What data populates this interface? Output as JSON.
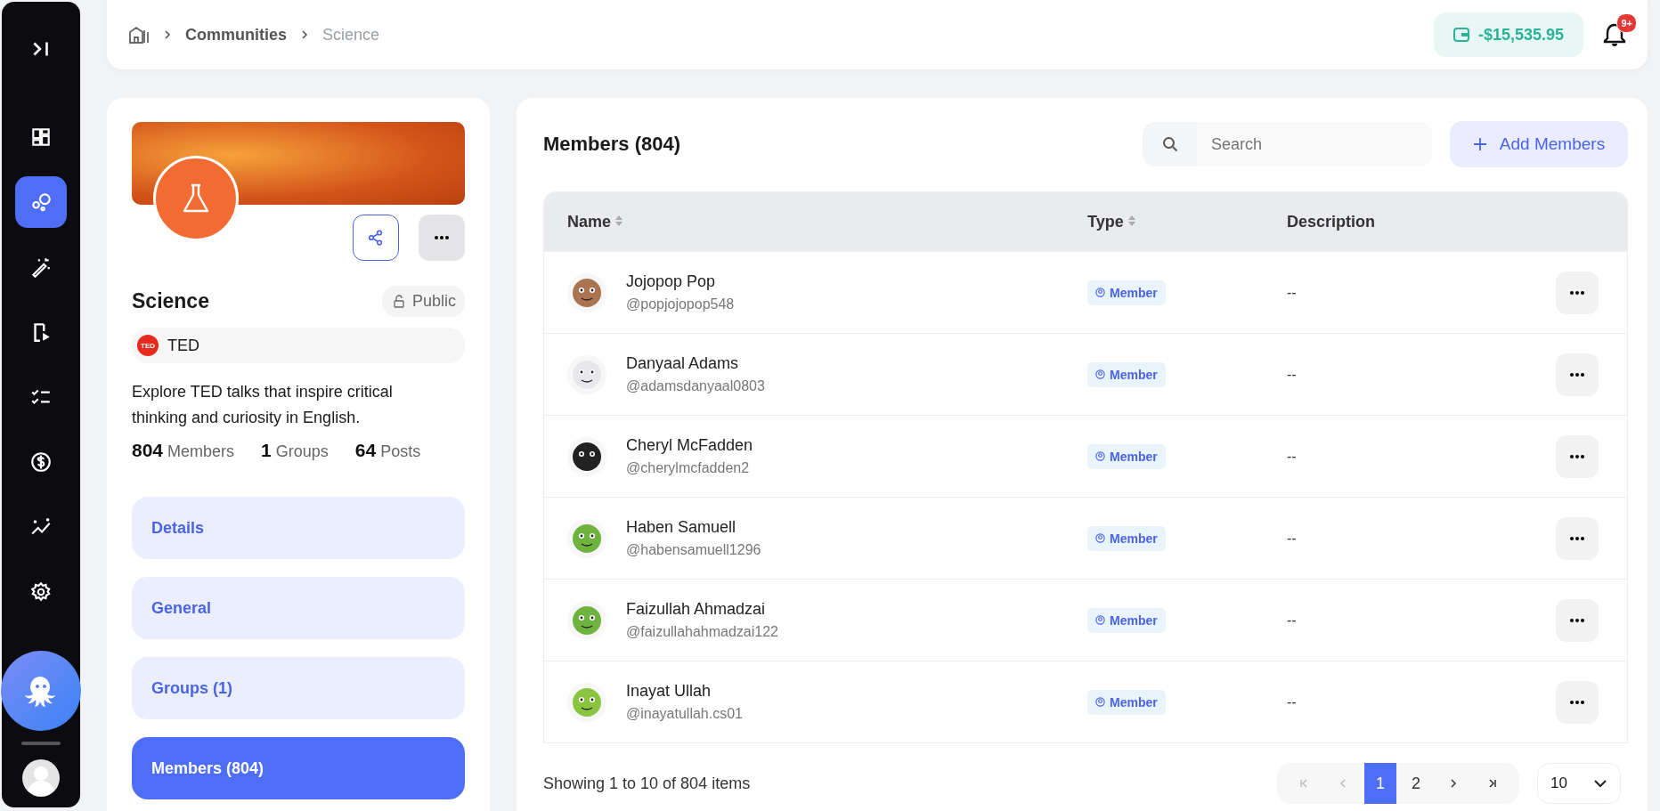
{
  "sidebar": {
    "items": [
      {
        "kind": "expand",
        "selected": false
      },
      {
        "kind": "dashboard",
        "selected": false
      },
      {
        "kind": "communities",
        "selected": true
      },
      {
        "kind": "magic",
        "selected": false
      },
      {
        "kind": "video",
        "selected": false
      },
      {
        "kind": "tasks",
        "selected": false
      },
      {
        "kind": "dollar",
        "selected": false
      },
      {
        "kind": "analytics",
        "selected": false
      },
      {
        "kind": "settings",
        "selected": false
      }
    ]
  },
  "header": {
    "breadcrumb": [
      "Communities",
      "Science"
    ],
    "wallet": "-$15,535.95",
    "notifications": "9+"
  },
  "community": {
    "name": "Science",
    "visibility": "Public",
    "owner_logo": "TED",
    "owner": "TED",
    "description": "Explore TED talks that inspire critical thinking and curiosity in English.",
    "stats": [
      "**804** Members",
      "**1** Groups",
      "**64** Posts"
    ],
    "tabs": [
      {
        "label": "Details",
        "selected": false
      },
      {
        "label": "General",
        "selected": false
      },
      {
        "label": "Groups (1)",
        "selected": false
      },
      {
        "label": "Members (804)",
        "selected": true
      }
    ]
  },
  "members": {
    "title": "Members (804)",
    "search": {
      "placeholder": "Search"
    },
    "add_button": "Add Members",
    "table": {
      "columns": [
        {
          "label": "Name",
          "sortable": true
        },
        {
          "label": "Type",
          "sortable": true
        },
        {
          "label": "Description",
          "sortable": false
        }
      ],
      "rows": [
        {
          "name": "Jojopop Pop",
          "handle": "@popjojopop548",
          "type": "Member",
          "description": "--",
          "color": "#a9744f"
        },
        {
          "name": "Danyaal Adams",
          "handle": "@adamsdanyaal0803",
          "type": "Member",
          "description": "--",
          "color": "#e8e8ec"
        },
        {
          "name": "Cheryl McFadden",
          "handle": "@cherylmcfadden2",
          "type": "Member",
          "description": "--",
          "color": "#222222"
        },
        {
          "name": "Haben Samuell",
          "handle": "@habensamuell1296",
          "type": "Member",
          "description": "--",
          "color": "#6fb33f"
        },
        {
          "name": "Faizullah Ahmadzai",
          "handle": "@faizullahahmadzai122",
          "type": "Member",
          "description": "--",
          "color": "#6fb33f"
        },
        {
          "name": "Inayat Ullah",
          "handle": "@inayatullah.cs01",
          "type": "Member",
          "description": "--",
          "color": "#8bc53f"
        }
      ]
    },
    "footer": "Showing 1 to 10 of 804 items",
    "pages": [
      {
        "label": "1",
        "selected": true
      },
      {
        "label": "2",
        "selected": false
      }
    ],
    "page_size": "10"
  }
}
